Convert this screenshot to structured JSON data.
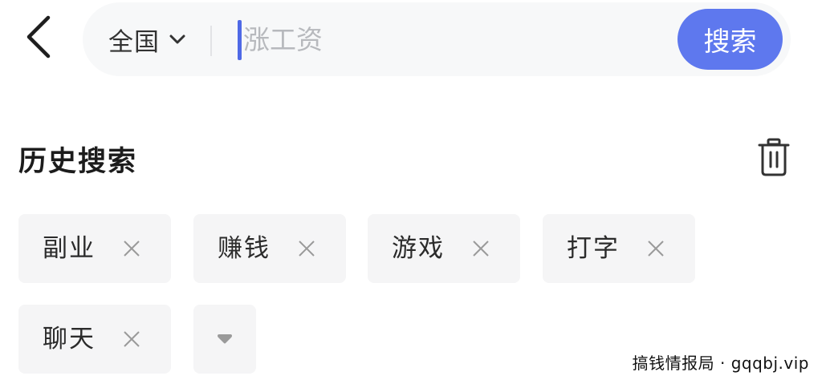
{
  "header": {
    "back_icon": "chevron-left-icon"
  },
  "search": {
    "region_label": "全国",
    "region_icon": "chevron-down-icon",
    "placeholder": "涨工资",
    "button_label": "搜索"
  },
  "history": {
    "title": "历史搜索",
    "clear_icon": "trash-icon",
    "items": [
      {
        "label": "副业",
        "remove_icon": "close-icon"
      },
      {
        "label": "赚钱",
        "remove_icon": "close-icon"
      },
      {
        "label": "游戏",
        "remove_icon": "close-icon"
      },
      {
        "label": "打字",
        "remove_icon": "close-icon"
      },
      {
        "label": "聊天",
        "remove_icon": "close-icon"
      }
    ],
    "expand_icon": "caret-down-icon"
  },
  "watermark": {
    "text": "搞钱情报局 · gqqbj.vip"
  },
  "colors": {
    "accent": "#5e78ee",
    "caret": "#4f69e6",
    "search_bar_bg": "#f7f8f9",
    "chip_bg": "#f5f5f6",
    "placeholder": "#b7b9bd"
  }
}
